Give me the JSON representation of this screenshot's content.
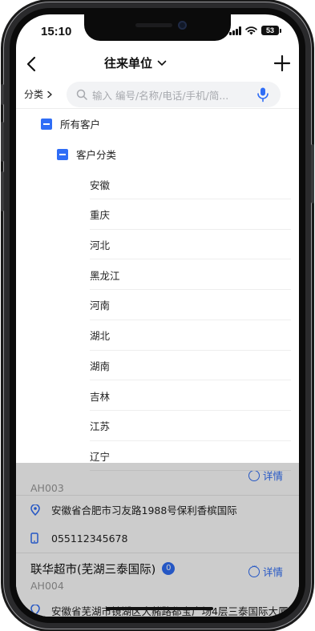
{
  "status": {
    "time": "15:10",
    "battery": "53"
  },
  "nav": {
    "title": "往来单位"
  },
  "search": {
    "category_label": "分类",
    "placeholder": "输入 编号/名称/电话/手机/简..."
  },
  "tree": {
    "root": "所有客户",
    "group": "客户分类",
    "regions": [
      "安徽",
      "重庆",
      "河北",
      "黑龙江",
      "河南",
      "湖北",
      "湖南",
      "吉林",
      "江苏",
      "辽宁"
    ]
  },
  "list": {
    "item1": {
      "code": "AH003",
      "address": "安徽省合肥市习友路1988号保利香槟国际",
      "phone": "055112345678",
      "detail_label": "详情"
    },
    "item2": {
      "name": "联华超市(芜湖三泰国际)",
      "badge": "0",
      "code": "AH004",
      "detail_label": "详情",
      "address_partial": "安徽省芜湖市镜湖区大赭路都宝广场4层三泰国际大厦"
    }
  },
  "colors": {
    "accent": "#2f6df6"
  }
}
